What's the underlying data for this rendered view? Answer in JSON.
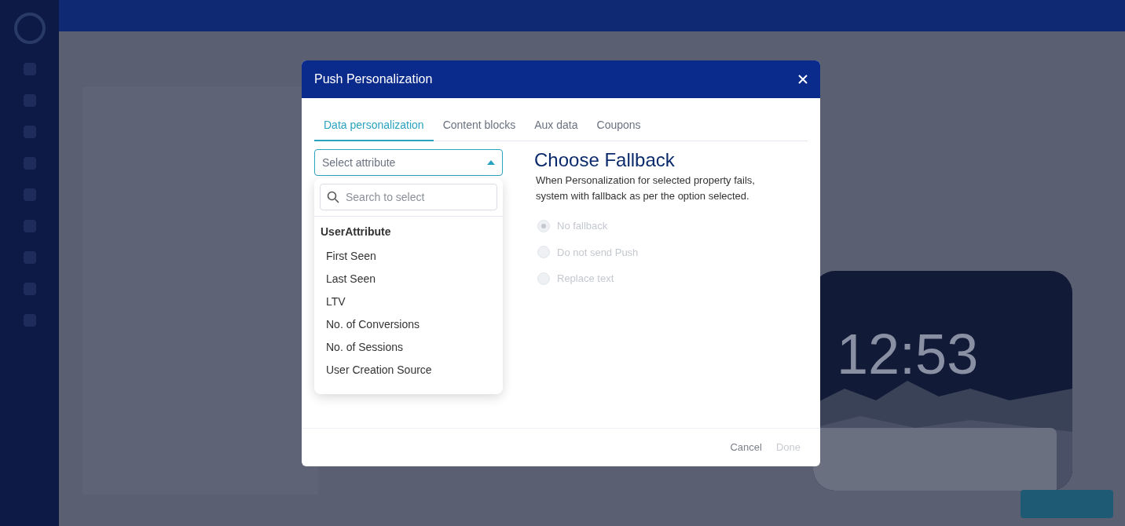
{
  "background": {
    "preview": {
      "clock": "12:53"
    }
  },
  "modal": {
    "title": "Push Personalization",
    "tabs": [
      {
        "label": "Data personalization",
        "selected": true
      },
      {
        "label": "Content blocks",
        "selected": false
      },
      {
        "label": "Aux data",
        "selected": false
      },
      {
        "label": "Coupons",
        "selected": false
      }
    ],
    "attribute_select": {
      "placeholder": "Select attribute",
      "expanded": true
    },
    "dropdown": {
      "search": {
        "placeholder": "Search to select"
      },
      "group": "UserAttribute",
      "options": [
        "First Seen",
        "Last Seen",
        "LTV",
        "No. of Conversions",
        "No. of Sessions",
        "User Creation Source"
      ]
    },
    "fallback": {
      "heading": "Choose Fallback",
      "description": "When Personalization for selected property fails, system with fallback as per the option selected.",
      "options": [
        {
          "label": "No fallback",
          "selected": true,
          "disabled": true
        },
        {
          "label": "Do not send Push",
          "selected": false,
          "disabled": true
        },
        {
          "label": "Replace text",
          "selected": false,
          "disabled": true
        }
      ]
    },
    "buttons": [
      {
        "label": "Cancel",
        "disabled": false
      },
      {
        "label": "Done",
        "disabled": true
      }
    ]
  }
}
